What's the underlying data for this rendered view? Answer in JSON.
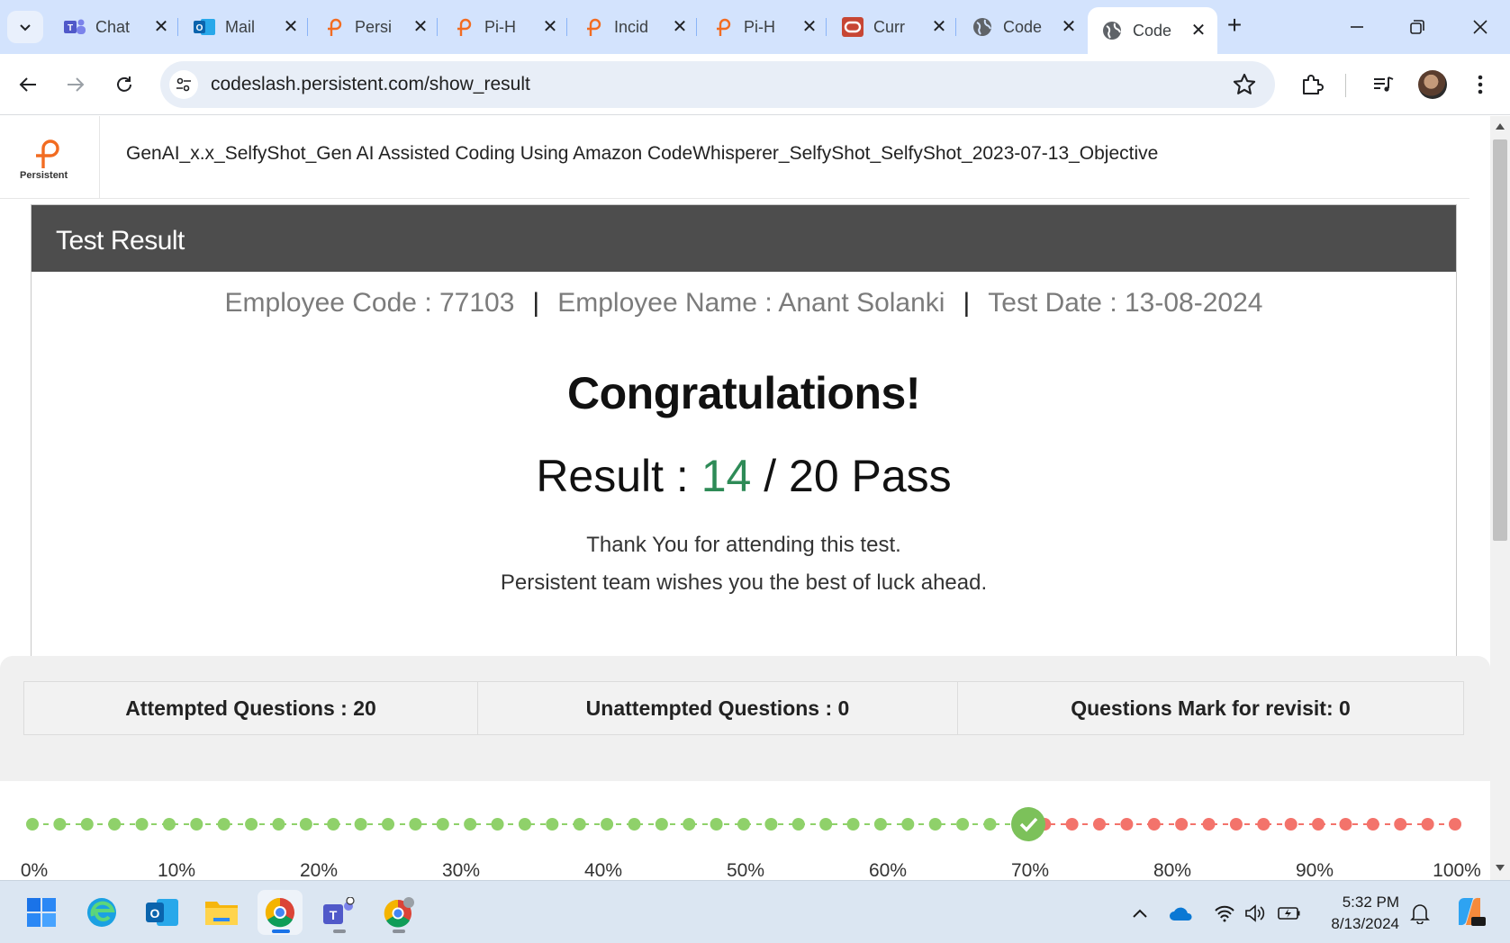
{
  "browser": {
    "tabs": [
      {
        "label": "Chat",
        "icon": "teams-icon"
      },
      {
        "label": "Mail",
        "icon": "outlook-icon"
      },
      {
        "label": "Persi",
        "icon": "persistent-icon"
      },
      {
        "label": "Pi-H",
        "icon": "persistent-icon"
      },
      {
        "label": "Incid",
        "icon": "persistent-icon"
      },
      {
        "label": "Pi-H",
        "icon": "persistent-icon"
      },
      {
        "label": "Curr",
        "icon": "oracle-icon"
      },
      {
        "label": "Code",
        "icon": "globe-icon"
      },
      {
        "label": "Code",
        "icon": "globe-icon",
        "active": true
      }
    ],
    "url": "codeslash.persistent.com/show_result"
  },
  "header": {
    "logo_text": "Persistent",
    "test_title": "GenAI_x.x_SelfyShot_Gen AI Assisted Coding Using Amazon CodeWhisperer_SelfyShot_SelfyShot_2023-07-13_Objective"
  },
  "result": {
    "heading": "Test Result",
    "employee_code": "Employee Code : 77103",
    "employee_name": "Employee Name : Anant Solanki",
    "test_date": "Test Date : 13-08-2024",
    "separator": "|",
    "congrats": "Congratulations!",
    "result_prefix": "Result : ",
    "score": "14",
    "result_suffix": " / 20 Pass",
    "thanks": "Thank You for attending this test.",
    "wishes": "Persistent team wishes you the best of luck ahead.",
    "accent_color": "#f26c21",
    "score_color": "#2e8b57"
  },
  "stats": {
    "attempted": "Attempted Questions : 20",
    "unattempted": "Unattempted Questions : 0",
    "revisit": "Questions Mark for revisit: 0"
  },
  "progress": {
    "score_fraction": 0.7,
    "tick_labels": [
      "0%",
      "10%",
      "20%",
      "30%",
      "40%",
      "50%",
      "60%",
      "70%",
      "80%",
      "90%",
      "100%"
    ],
    "pass_color": "#8fd16a",
    "fail_color": "#f3736b",
    "marker_color": "#7cc15a"
  },
  "taskbar": {
    "apps": [
      "windows-start-icon",
      "edge-icon",
      "outlook-icon",
      "file-explorer-icon",
      "chrome-icon",
      "teams-icon",
      "chrome-profile-icon"
    ],
    "time": "5:32 PM",
    "date": "8/13/2024"
  }
}
